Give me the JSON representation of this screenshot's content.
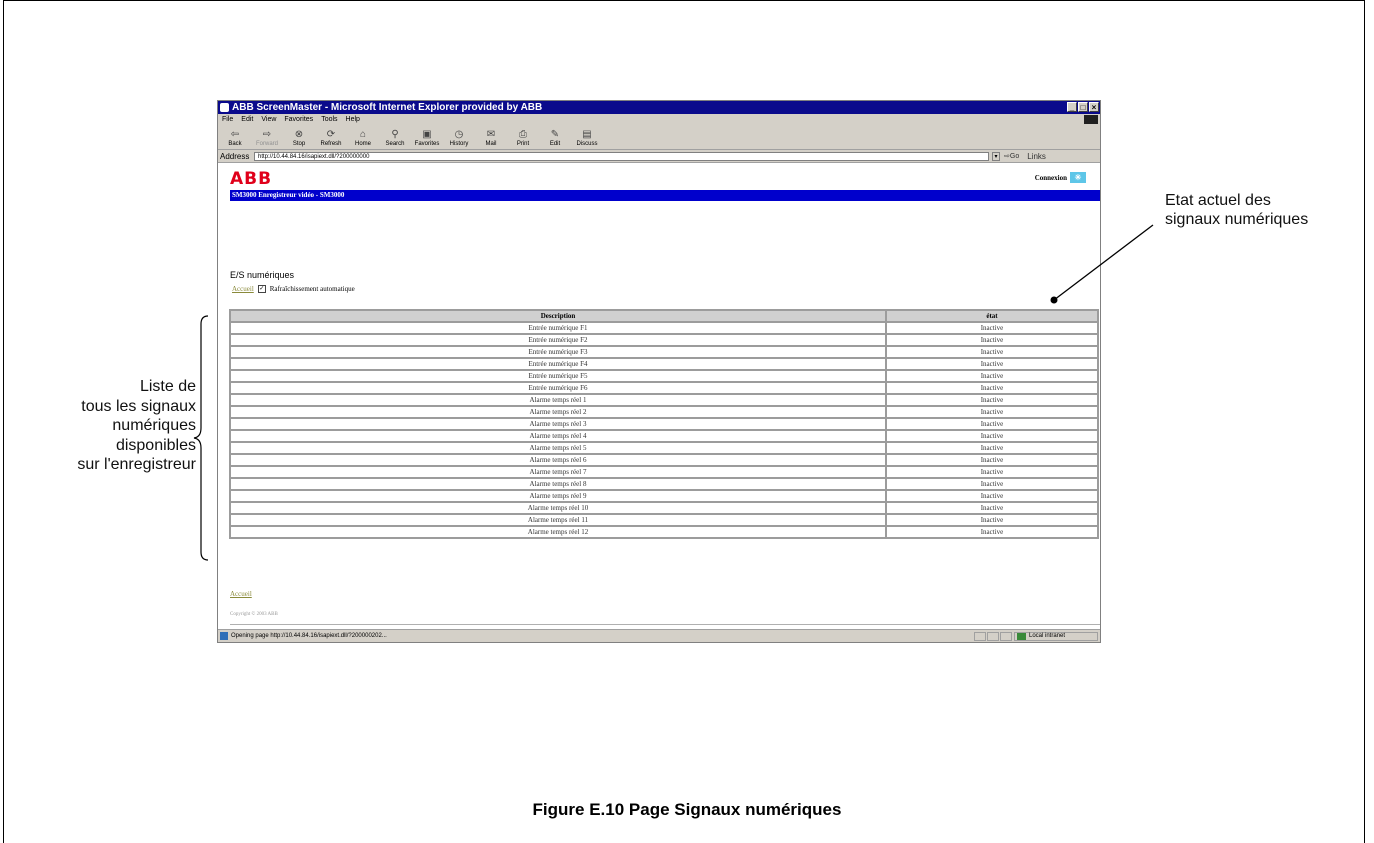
{
  "browser": {
    "title": "ABB ScreenMaster - Microsoft Internet Explorer provided by ABB",
    "menu": [
      "File",
      "Edit",
      "View",
      "Favorites",
      "Tools",
      "Help"
    ],
    "toolbar": {
      "back": "Back",
      "forward": "Forward",
      "stop": "Stop",
      "refresh": "Refresh",
      "home": "Home",
      "search": "Search",
      "favorites": "Favorites",
      "history": "History",
      "mail": "Mail",
      "print": "Print",
      "edit": "Edit",
      "discuss": "Discuss"
    },
    "address_label": "Address",
    "address_url": "http://10.44.84.16/isapiext.dll/?200000000",
    "go_label": "Go",
    "links_label": "Links",
    "status_text": "Opening page http://10.44.84.16/isapiext.dll/?200000202...",
    "zone_label": "Local intranet"
  },
  "page": {
    "logo": "ABB",
    "connexion_label": "Connexion",
    "banner": "SM3000 Enregistreur vidéo - SM3000",
    "section_title": "E/S numériques",
    "home_link": "Accueil",
    "auto_refresh_label": "Rafraîchissement automatique",
    "table": {
      "headers": [
        "Description",
        "état"
      ],
      "rows": [
        [
          "Entrée numérique F1",
          "Inactive"
        ],
        [
          "Entrée numérique F2",
          "Inactive"
        ],
        [
          "Entrée numérique F3",
          "Inactive"
        ],
        [
          "Entrée numérique F4",
          "Inactive"
        ],
        [
          "Entrée numérique F5",
          "Inactive"
        ],
        [
          "Entrée numérique F6",
          "Inactive"
        ],
        [
          "Alarme temps réel 1",
          "Inactive"
        ],
        [
          "Alarme temps réel 2",
          "Inactive"
        ],
        [
          "Alarme temps réel 3",
          "Inactive"
        ],
        [
          "Alarme temps réel 4",
          "Inactive"
        ],
        [
          "Alarme temps réel 5",
          "Inactive"
        ],
        [
          "Alarme temps réel 6",
          "Inactive"
        ],
        [
          "Alarme temps réel 7",
          "Inactive"
        ],
        [
          "Alarme temps réel 8",
          "Inactive"
        ],
        [
          "Alarme temps réel 9",
          "Inactive"
        ],
        [
          "Alarme temps réel 10",
          "Inactive"
        ],
        [
          "Alarme temps réel 11",
          "Inactive"
        ],
        [
          "Alarme temps réel 12",
          "Inactive"
        ]
      ]
    },
    "footer_link": "Accueil",
    "copyright": "Copyright © 2003 ABB"
  },
  "annotations": {
    "right": [
      "Etat actuel des",
      "signaux numériques"
    ],
    "left": [
      "Liste de",
      "tous les signaux",
      "numériques",
      "disponibles",
      "sur l'enregistreur"
    ]
  },
  "caption": "Figure E.10 Page Signaux numériques"
}
